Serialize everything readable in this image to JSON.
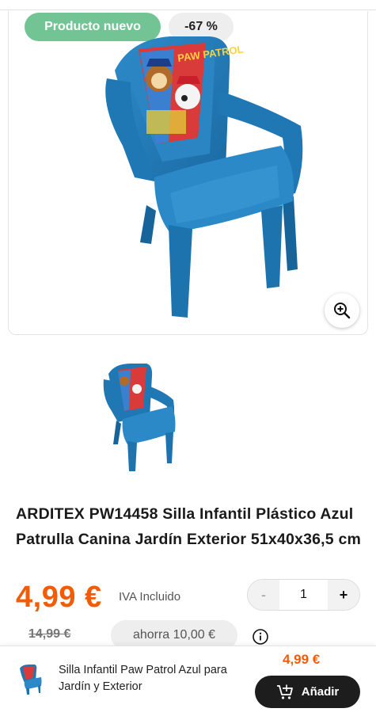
{
  "badges": {
    "new_label": "Producto nuevo",
    "discount_label": "-67 %"
  },
  "image": {
    "printed_text": "PAW PATROL",
    "chair_color": "#1f78b4"
  },
  "product": {
    "title": "ARDITEX PW14458 Silla Infantil Plástico Azul Patrulla Canina Jardín Exterior 51x40x36,5 cm",
    "price": "4,99 €",
    "tax_note": "IVA Incluido",
    "old_price": "14,99 €",
    "savings": "ahorra  10,00 €"
  },
  "quantity": {
    "minus": "-",
    "value": "1",
    "plus": "+"
  },
  "sticky_bar": {
    "title": "Silla Infantil Paw Patrol Azul para Jardín y Exterior",
    "price": "4,99 €",
    "add_label": "Añadir"
  },
  "icons": {
    "zoom": "zoom-in-icon",
    "info": "info-icon",
    "cart": "add-to-cart-icon"
  },
  "colors": {
    "accent": "#f25c05",
    "badge_new": "#72c495",
    "button_dark": "#1d1d1d"
  }
}
